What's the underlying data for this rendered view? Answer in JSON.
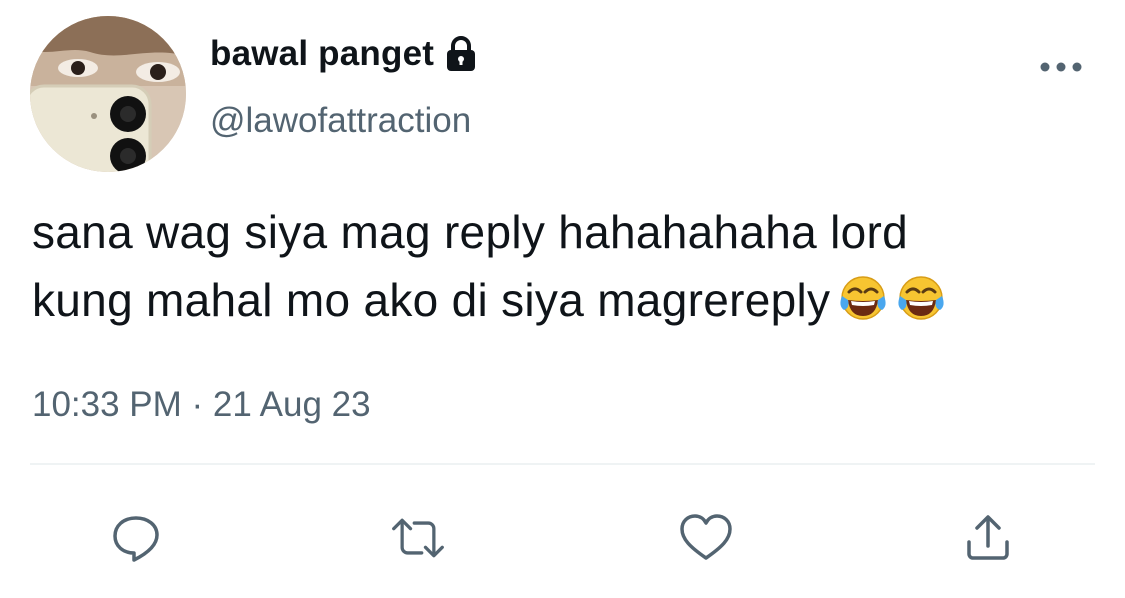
{
  "author": {
    "display_name": "bawal panget",
    "handle": "@lawofattraction",
    "protected_icon": "lock-icon",
    "avatar": "avatar-photo"
  },
  "tweet": {
    "line1": "sana wag siya mag reply hahahahaha lord",
    "line2": "kung mahal mo ako di siya magrereply",
    "emoji": [
      "face-with-tears-of-joy",
      "face-with-tears-of-joy"
    ],
    "timestamp": "10:33 PM · 21 Aug 23"
  },
  "menu": {
    "icon": "more-icon"
  },
  "actions": [
    {
      "name": "reply",
      "icon": "reply-icon"
    },
    {
      "name": "retweet",
      "icon": "retweet-icon"
    },
    {
      "name": "like",
      "icon": "heart-icon"
    },
    {
      "name": "share",
      "icon": "share-icon"
    }
  ],
  "colors": {
    "text": "#0f1419",
    "secondary": "#536471",
    "divider": "#eff3f4",
    "icon": "#536471"
  }
}
